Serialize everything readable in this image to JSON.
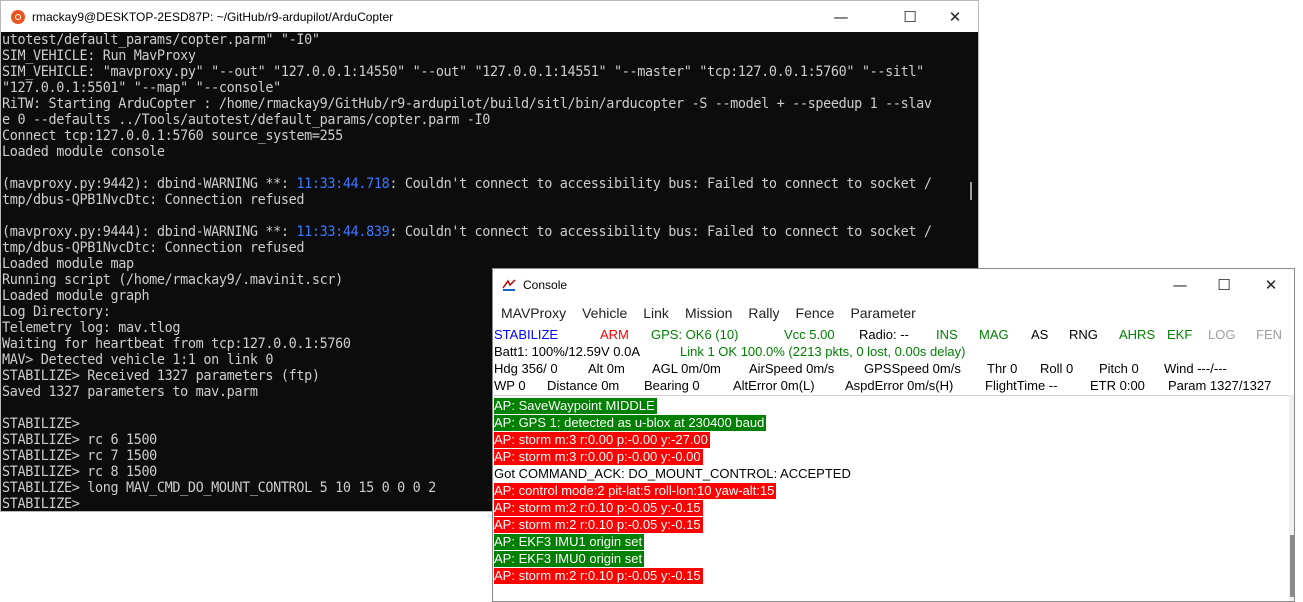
{
  "terminal": {
    "title": "rmackay9@DESKTOP-2ESD87P: ~/GitHub/r9-ardupilot/ArduCopter",
    "lines": [
      "utotest/default_params/copter.parm\" \"-I0\"",
      "SIM_VEHICLE: Run MavProxy",
      "SIM_VEHICLE: \"mavproxy.py\" \"--out\" \"127.0.0.1:14550\" \"--out\" \"127.0.0.1:14551\" \"--master\" \"tcp:127.0.0.1:5760\" \"--sitl\"",
      "\"127.0.0.1:5501\" \"--map\" \"--console\"",
      "RiTW: Starting ArduCopter : /home/rmackay9/GitHub/r9-ardupilot/build/sitl/bin/arducopter -S --model + --speedup 1 --slav",
      "e 0 --defaults ../Tools/autotest/default_params/copter.parm -I0",
      "Connect tcp:127.0.0.1:5760 source_system=255",
      "Loaded module console",
      "",
      "(mavproxy.py:9442): dbind-WARNING **: ",
      "tmp/dbus-QPB1NvcDtc: Connection refused",
      "",
      "(mavproxy.py:9444): dbind-WARNING **: ",
      "tmp/dbus-QPB1NvcDtc: Connection refused",
      "Loaded module map",
      "Running script (/home/rmackay9/.mavinit.scr)",
      "Loaded module graph",
      "Log Directory:",
      "Telemetry log: mav.tlog",
      "Waiting for heartbeat from tcp:127.0.0.1:5760",
      "MAV> Detected vehicle 1:1 on link 0",
      "STABILIZE> Received 1327 parameters (ftp)",
      "Saved 1327 parameters to mav.parm",
      "",
      "STABILIZE>",
      "STABILIZE> rc 6 1500",
      "STABILIZE> rc 7 1500",
      "STABILIZE> rc 8 1500",
      "STABILIZE> long MAV_CMD_DO_MOUNT_CONTROL 5 10 15 0 0 0 2",
      "STABILIZE>"
    ],
    "warn1_time": "11:33:44.718",
    "warn1_rest": ": Couldn't connect to accessibility bus: Failed to connect to socket /",
    "warn2_time": "11:33:44.839",
    "warn2_rest": ": Couldn't connect to accessibility bus: Failed to connect to socket /",
    "minimize_glyph": "—",
    "maximize_glyph": "☐",
    "close_glyph": "✕"
  },
  "console": {
    "title": "Console",
    "menu": [
      "MAVProxy",
      "Vehicle",
      "Link",
      "Mission",
      "Rally",
      "Fence",
      "Parameter"
    ],
    "status_row1": [
      {
        "text": "STABILIZE",
        "color": "#0000ff"
      },
      {
        "text": "ARM",
        "color": "#ff0000"
      },
      {
        "text": "GPS: OK6 (10)",
        "color": "#008000"
      },
      {
        "text": "Vcc 5.00",
        "color": "#008000"
      },
      {
        "text": "Radio: --",
        "color": "#000000"
      },
      {
        "text": "INS",
        "color": "#008000"
      },
      {
        "text": "MAG",
        "color": "#008000"
      },
      {
        "text": "AS",
        "color": "#000000"
      },
      {
        "text": "RNG",
        "color": "#000000"
      },
      {
        "text": "AHRS",
        "color": "#008000"
      },
      {
        "text": "EKF",
        "color": "#008000"
      },
      {
        "text": "LOG",
        "color": "#a0a0a0"
      },
      {
        "text": "FEN",
        "color": "#a0a0a0"
      }
    ],
    "status_row2": [
      {
        "text": "Batt1: 100%/12.59V 0.0A",
        "color": "#000000"
      },
      {
        "text": "Link 1 OK 100.0% (2213 pkts, 0 lost, 0.00s delay)",
        "color": "#008000"
      }
    ],
    "status_row3": [
      "Hdg 356/  0",
      "Alt 0m",
      "AGL 0m/0m",
      "AirSpeed 0m/s",
      "GPSSpeed 0m/s",
      "Thr 0",
      "Roll 0",
      "Pitch 0",
      "Wind ---/---"
    ],
    "status_row4": [
      "WP 0",
      "Distance 0m",
      "Bearing 0",
      "AltError 0m(L)",
      "AspdError 0m/s(H)",
      "FlightTime --",
      "ETR 0:00",
      "Param 1327/1327"
    ],
    "messages": [
      {
        "text": "AP: SaveWaypoint MIDDLE",
        "kind": "g"
      },
      {
        "text": "AP: GPS 1: detected as u-blox at 230400 baud",
        "kind": "g"
      },
      {
        "text": "AP: storm m:3 r:0.00 p:-0.00 y:-27.00",
        "kind": "r"
      },
      {
        "text": "AP: storm m:3 r:0.00 p:-0.00 y:-0.00",
        "kind": "r"
      },
      {
        "text": "Got COMMAND_ACK: DO_MOUNT_CONTROL: ACCEPTED",
        "kind": "n"
      },
      {
        "text": "AP: control mode:2 pit-lat:5 roll-lon:10 yaw-alt:15",
        "kind": "r"
      },
      {
        "text": "AP: storm m:2 r:0.10 p:-0.05 y:-0.15",
        "kind": "r"
      },
      {
        "text": "AP: storm m:2 r:0.10 p:-0.05 y:-0.15",
        "kind": "r"
      },
      {
        "text": "AP: EKF3 IMU1 origin set",
        "kind": "g"
      },
      {
        "text": "AP: EKF3 IMU0 origin set",
        "kind": "g"
      },
      {
        "text": "AP: storm m:2 r:0.10 p:-0.05 y:-0.15",
        "kind": "r"
      }
    ],
    "minimize_glyph": "—",
    "maximize_glyph": "☐",
    "close_glyph": "✕"
  }
}
